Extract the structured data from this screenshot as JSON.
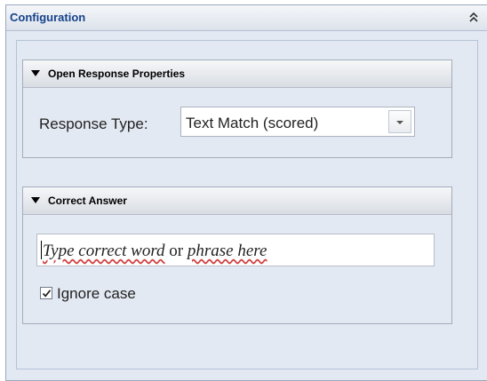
{
  "panel": {
    "title": "Configuration",
    "collapse_icon": "double-chevron-up-icon"
  },
  "open_response": {
    "title": "Open Response Properties",
    "response_type_label": "Response Type:",
    "response_type_value": "Text Match (scored)"
  },
  "correct_answer": {
    "title": "Correct Answer",
    "placeholder_part1": "Type correct word",
    "placeholder_part2": " or ",
    "placeholder_part3": "phrase here",
    "ignore_case_label": "Ignore case",
    "ignore_case_checked": true
  },
  "colors": {
    "panel_background": "#e3e9f3",
    "header_title": "#15428b",
    "spellcheck_underline": "#d24444"
  }
}
